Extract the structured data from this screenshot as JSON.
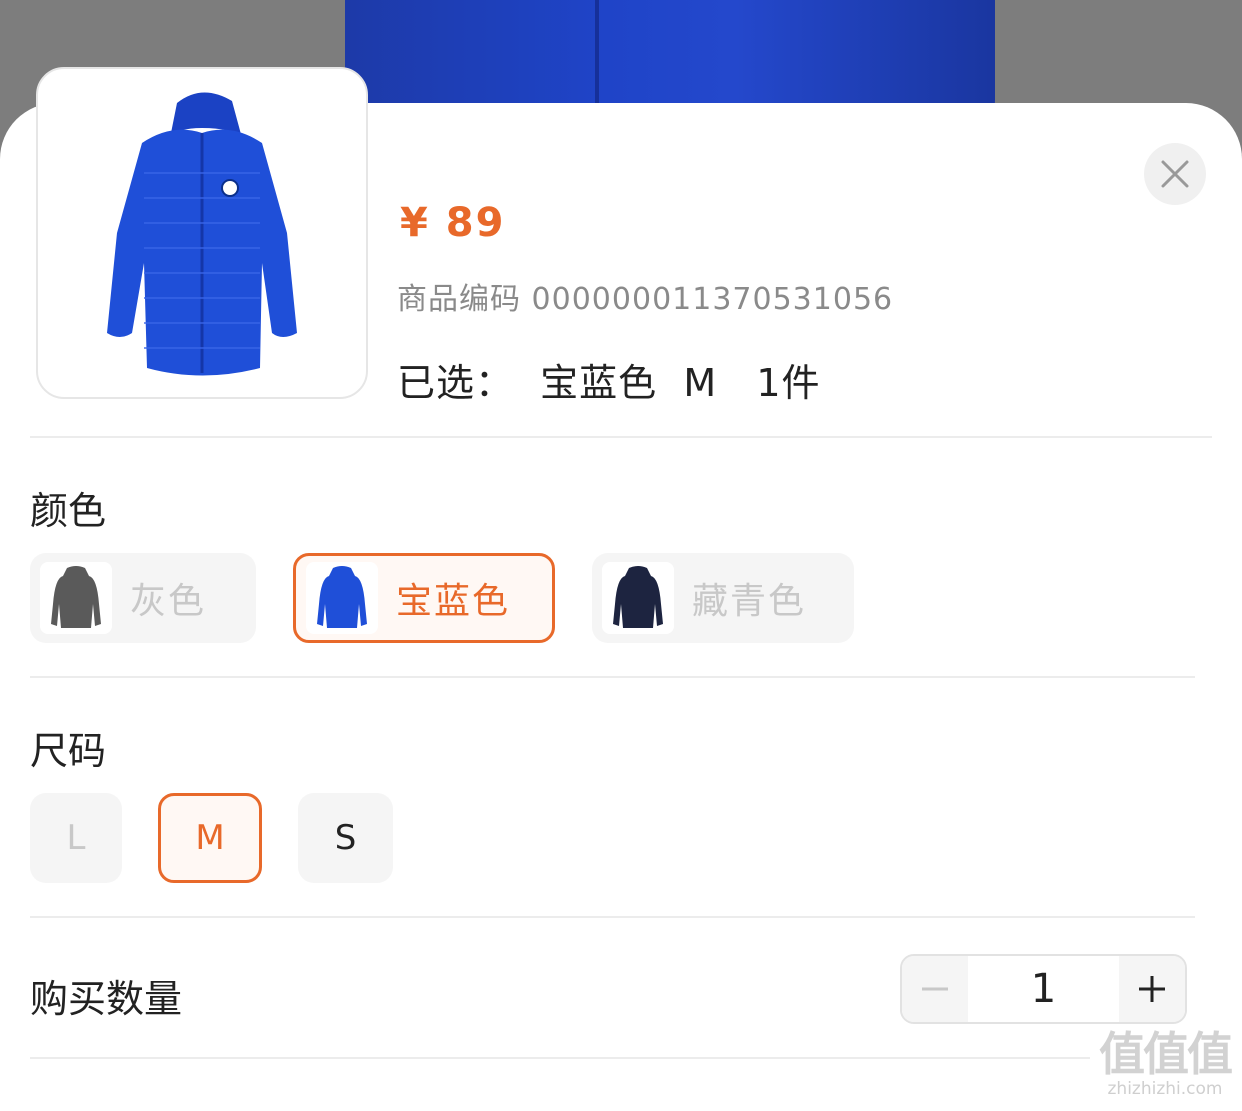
{
  "product": {
    "price": "¥ 89",
    "sku_label": "商品编码",
    "sku_number": "000000011370531056",
    "selected_text": "已选：  宝蓝色  M   1件"
  },
  "sections": {
    "color_title": "颜色",
    "size_title": "尺码",
    "quantity_title": "购买数量"
  },
  "colors": [
    {
      "label": "灰色",
      "state": "disabled",
      "swatch_color": "#5a5a5a"
    },
    {
      "label": "宝蓝色",
      "state": "selected",
      "swatch_color": "#1f4fd8"
    },
    {
      "label": "藏青色",
      "state": "available",
      "swatch_color": "#1d2440"
    }
  ],
  "sizes": [
    {
      "label": "L",
      "state": "disabled"
    },
    {
      "label": "M",
      "state": "selected"
    },
    {
      "label": "S",
      "state": "available"
    }
  ],
  "quantity": {
    "value": "1"
  },
  "watermark": {
    "logo_text": "值值值",
    "domain": "zhizhizhi.com"
  },
  "theme": {
    "accent": "#e8692a",
    "product_blue": "#1f4fd8"
  }
}
